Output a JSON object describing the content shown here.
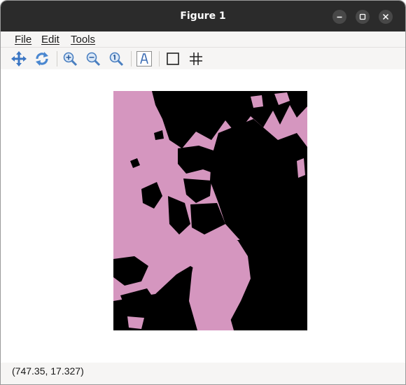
{
  "window": {
    "title": "Figure 1"
  },
  "menubar": {
    "items": [
      {
        "label": "File"
      },
      {
        "label": "Edit"
      },
      {
        "label": "Tools"
      }
    ]
  },
  "toolbar": {
    "buttons": [
      {
        "icon": "pan-move-icon"
      },
      {
        "icon": "refresh-icon"
      },
      {
        "icon": "zoom-in-icon"
      },
      {
        "icon": "zoom-out-icon"
      },
      {
        "icon": "zoom-reset-icon"
      },
      {
        "icon": "text-label-icon"
      },
      {
        "icon": "rectangle-icon"
      },
      {
        "icon": "grid-icon"
      }
    ]
  },
  "figure": {
    "colors": {
      "foreground": "#d596bf",
      "background": "#000000"
    }
  },
  "statusbar": {
    "coordinates": "(747.35, 17.327)"
  }
}
